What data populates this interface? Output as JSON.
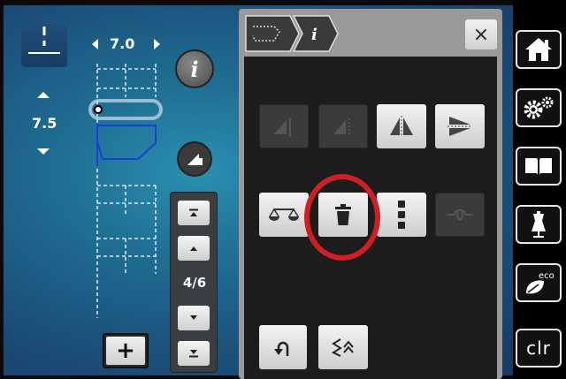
{
  "left": {
    "stitch_width": "7.0",
    "stitch_length": "7.5"
  },
  "nav": {
    "page_indicator": "4/6"
  },
  "panel": {
    "close_label": "×",
    "info_glyph": "i"
  },
  "sidebar": {
    "items": [
      {
        "name": "home",
        "icon": "home-icon"
      },
      {
        "name": "setup",
        "icon": "gears-icon"
      },
      {
        "name": "tutorial",
        "icon": "book-icon"
      },
      {
        "name": "consultant",
        "icon": "dress-form-icon"
      },
      {
        "name": "eco",
        "icon": "eco-leaf-icon",
        "label": "eco"
      },
      {
        "name": "clear",
        "label": "clr"
      }
    ]
  },
  "colors": {
    "highlight_ring": "#d01f24",
    "stitch_line": "#1a3fd6"
  },
  "add_label": "+"
}
